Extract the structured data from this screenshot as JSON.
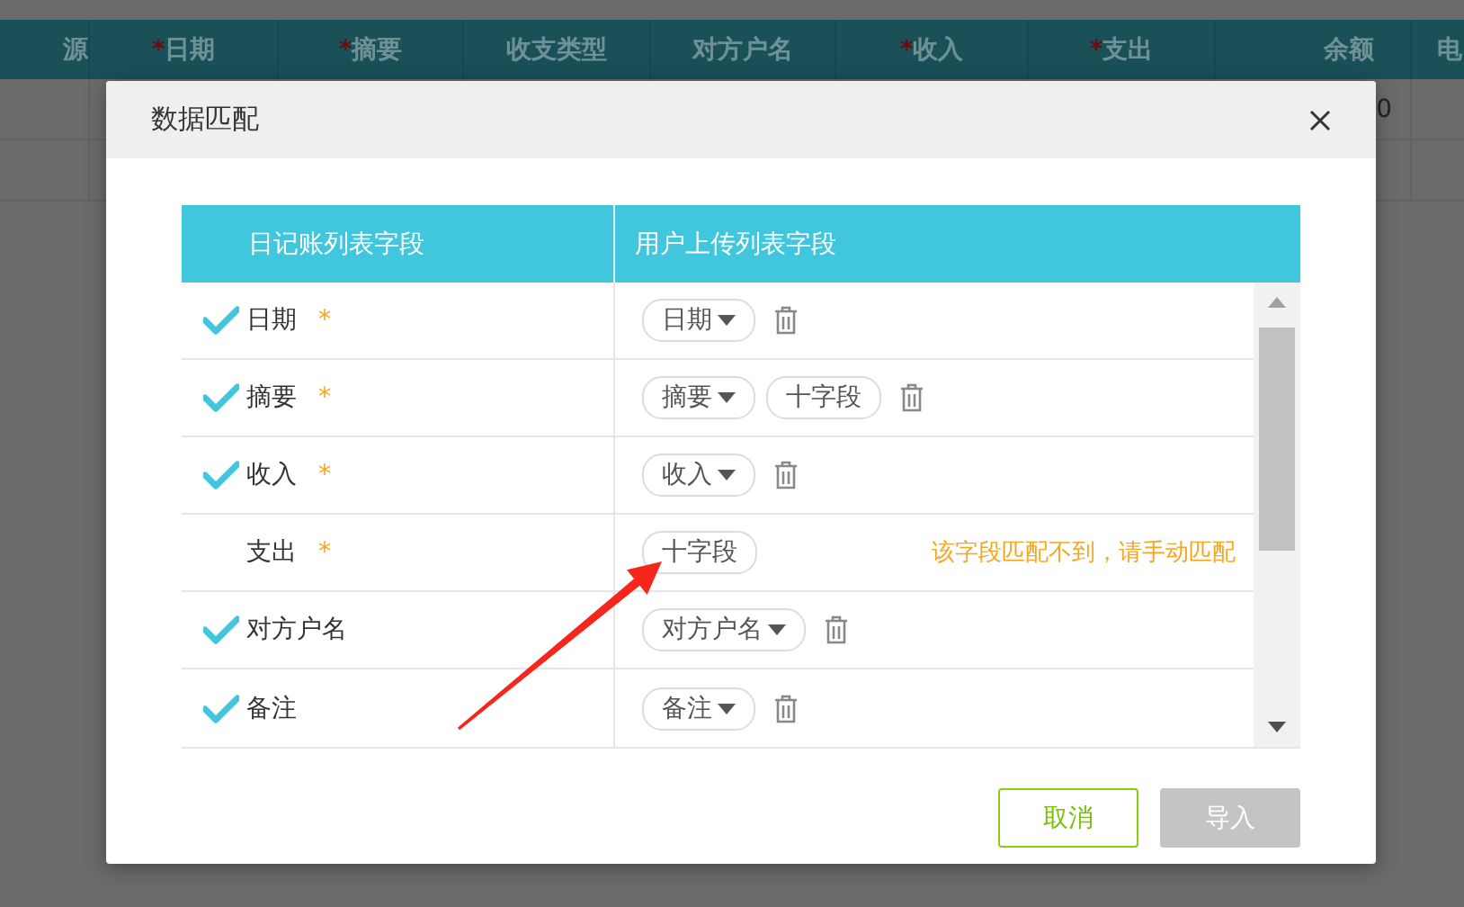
{
  "background_table": {
    "columns": [
      {
        "label": "源"
      },
      {
        "mark": "*",
        "label": "日期"
      },
      {
        "mark": "*",
        "label": "摘要"
      },
      {
        "label": "收支类型"
      },
      {
        "label": "对方户名"
      },
      {
        "mark": "*",
        "label": "收入"
      },
      {
        "mark": "*",
        "label": "支出"
      },
      {
        "label": "余额"
      },
      {
        "label": "电"
      }
    ],
    "rows": [
      {
        "balance": "0"
      }
    ]
  },
  "dialog": {
    "title": "数据匹配",
    "columns": [
      "日记账列表字段",
      "用户上传列表字段"
    ],
    "rows": [
      {
        "matched": true,
        "label": "日期",
        "mark": "*",
        "chips": [
          {
            "kind": "select",
            "text": "日期"
          }
        ],
        "deletable": true
      },
      {
        "matched": true,
        "label": "摘要",
        "mark": "*",
        "chips": [
          {
            "kind": "select",
            "text": "摘要"
          },
          {
            "kind": "add",
            "text": "十字段"
          }
        ],
        "deletable": true
      },
      {
        "matched": true,
        "label": "收入",
        "mark": "*",
        "chips": [
          {
            "kind": "select",
            "text": "收入"
          }
        ],
        "deletable": true
      },
      {
        "matched": false,
        "label": "支出",
        "mark": "*",
        "chips": [
          {
            "kind": "add",
            "text": "十字段"
          }
        ],
        "deletable": false,
        "message": "该字段匹配不到，请手动匹配"
      },
      {
        "matched": true,
        "label": "对方户名",
        "chips": [
          {
            "kind": "select",
            "text": "对方户名"
          }
        ],
        "deletable": true
      },
      {
        "matched": true,
        "label": "备注",
        "chips": [
          {
            "kind": "select",
            "text": "备注"
          }
        ],
        "deletable": true
      }
    ],
    "buttons": [
      {
        "kind": "cancel",
        "label": "取消",
        "disabled": false
      },
      {
        "kind": "primary",
        "label": "导入",
        "disabled": true
      }
    ]
  },
  "annotation_arrow": true
}
